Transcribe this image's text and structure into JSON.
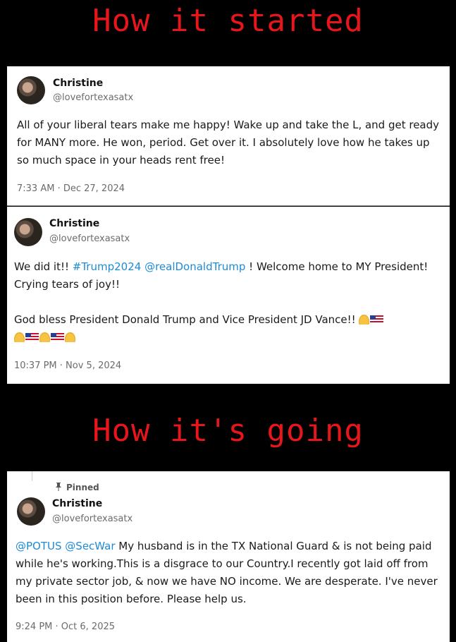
{
  "banners": {
    "top": "How it started",
    "middle": "How it's going"
  },
  "colors": {
    "banner": "#e8151b",
    "link": "#1d8bd6",
    "background": "#000000"
  },
  "tweets": [
    {
      "name": "Christine",
      "handle": "@lovefortexasatx",
      "text": "All of your liberal tears make me happy! Wake up and take the L, and get ready for MANY more. He won, period. Get over it. I absolutely love how he takes up so much space in your heads rent free!",
      "timestamp": "7:33 AM · Dec 27, 2024"
    },
    {
      "name": "Christine",
      "handle": "@lovefortexasatx",
      "text_prefix": "We did it!! ",
      "hashtag": "#Trump2024",
      "mention": "@realDonaldTrump",
      "text_after_mention": " ! Welcome home to MY President!  Crying tears of joy!!",
      "text_para2": "God bless President Donald Trump and Vice President JD Vance!! ",
      "emoji_names": [
        "folded-hands",
        "us-flag"
      ],
      "timestamp": "10:37 PM · Nov 5, 2024"
    },
    {
      "pinned_label": "Pinned",
      "name": "Christine",
      "handle": "@lovefortexasatx",
      "mention1": "@POTUS",
      "mention2": "@SecWar",
      "text": " My husband is in the TX National Guard & is not being paid while he's working.This is a disgrace to our Country.I recently got laid off from my private sector job, & now we have NO income. We are desperate. I've never been in this position before. Please help us.",
      "timestamp": "9:24 PM · Oct 6, 2025"
    }
  ]
}
